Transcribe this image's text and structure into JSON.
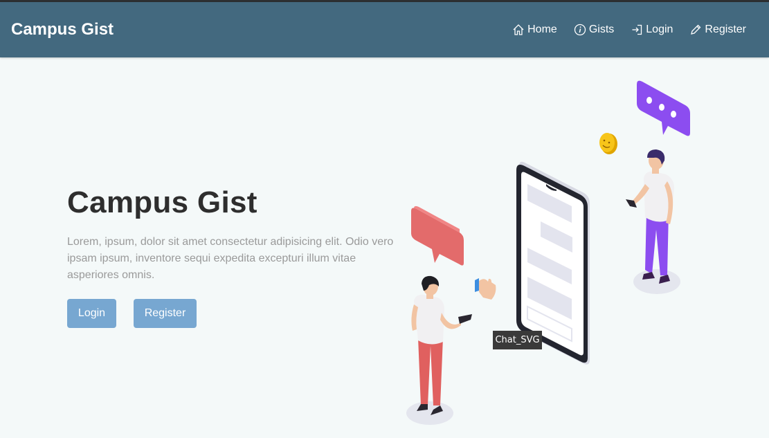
{
  "app": {
    "brand": "Campus Gist"
  },
  "nav": {
    "items": [
      {
        "label": "Home",
        "icon": "home-icon"
      },
      {
        "label": "Gists",
        "icon": "info-icon"
      },
      {
        "label": "Login",
        "icon": "login-icon"
      },
      {
        "label": "Register",
        "icon": "pencil-icon"
      }
    ]
  },
  "hero": {
    "title": "Campus Gist",
    "text": "Lorem, ipsum, dolor sit amet consectetur adipisicing elit. Odio vero ipsam ipsum, inventore sequi expedita excepturi illum vitae asperiores omnis.",
    "login_label": "Login",
    "register_label": "Register"
  },
  "tooltip": {
    "text": "Chat_SVG"
  },
  "colors": {
    "navbar": "#43697f",
    "background": "#f4f9f9",
    "button": "#77a7d1",
    "title": "#2e2e2e",
    "text": "#9a9a9a"
  }
}
